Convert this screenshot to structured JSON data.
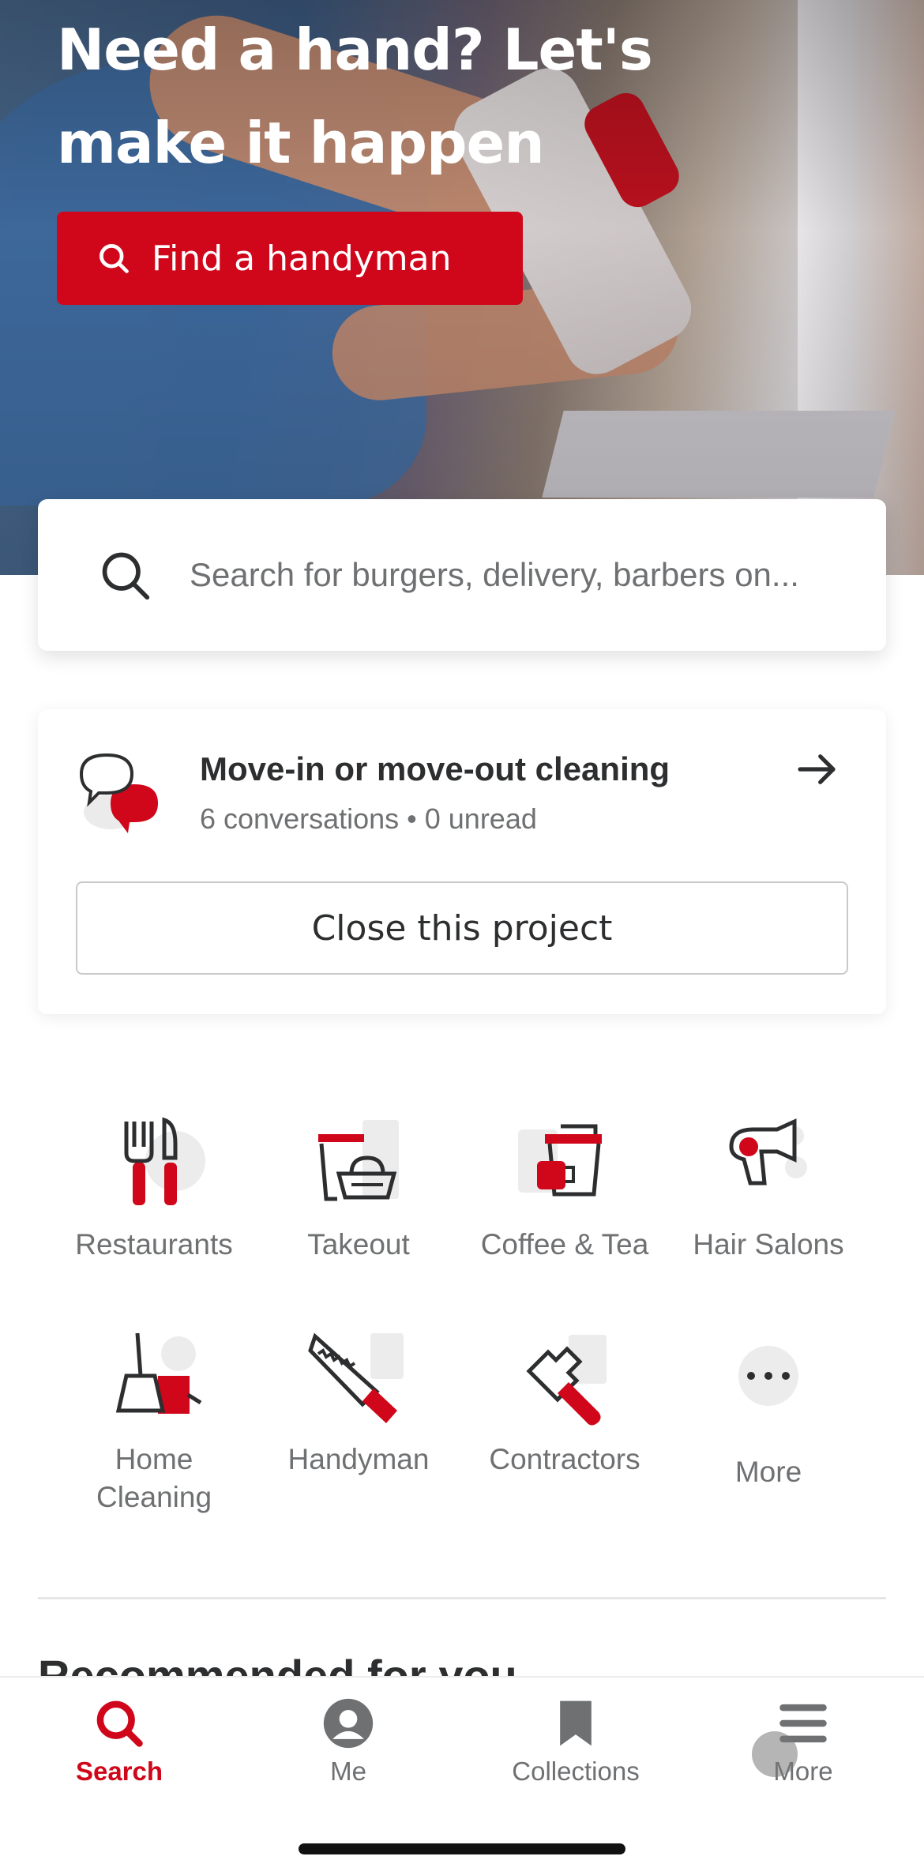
{
  "hero": {
    "title": "Need a hand? Let's make it happen",
    "button_label": "Find a handyman"
  },
  "search": {
    "placeholder": "Search for burgers, delivery, barbers on..."
  },
  "project": {
    "title": "Move-in or move-out cleaning",
    "subtitle": "6 conversations • 0 unread",
    "close_label": "Close this project"
  },
  "categories": [
    {
      "label": "Restaurants",
      "icon": "fork-knife-icon"
    },
    {
      "label": "Takeout",
      "icon": "takeout-basket-icon"
    },
    {
      "label": "Coffee & Tea",
      "icon": "coffee-cup-icon"
    },
    {
      "label": "Hair Salons",
      "icon": "hair-dryer-icon"
    },
    {
      "label": "Home Cleaning",
      "icon": "broom-icon"
    },
    {
      "label": "Handyman",
      "icon": "saw-icon"
    },
    {
      "label": "Contractors",
      "icon": "hammer-icon"
    },
    {
      "label": "More",
      "icon": "more-dots-icon"
    }
  ],
  "section": {
    "recommended_title": "Recommended for you"
  },
  "tabs": [
    {
      "label": "Search",
      "active": true
    },
    {
      "label": "Me",
      "active": false
    },
    {
      "label": "Collections",
      "active": false
    },
    {
      "label": "More",
      "active": false
    }
  ],
  "colors": {
    "brand_red": "#d0061a",
    "text_dark": "#2d2e2f",
    "text_gray": "#6e7072"
  }
}
